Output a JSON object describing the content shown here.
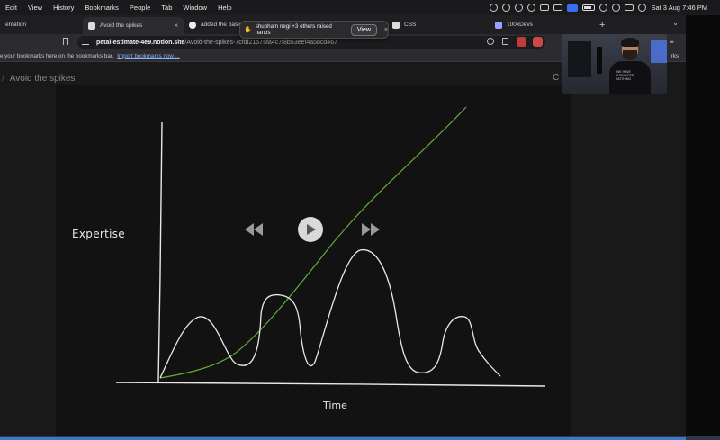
{
  "menubar": {
    "items": [
      "Edit",
      "View",
      "History",
      "Bookmarks",
      "People",
      "Tab",
      "Window",
      "Help"
    ],
    "datetime": "Sat 3 Aug  7:46 PM"
  },
  "tabs": [
    {
      "label": "entation",
      "icon": "doc-icon",
      "active": false
    },
    {
      "label": "Avoid the spikes",
      "icon": "notion-icon",
      "active": true
    },
    {
      "label": "added the basic",
      "icon": "github-icon",
      "active": false
    },
    {
      "label": "CSS",
      "icon": "notion-icon",
      "active": false
    },
    {
      "label": "100xDevs",
      "icon": "doc-icon",
      "active": false
    }
  ],
  "toast": {
    "message": "shubham negi +3 others raised hands",
    "view_label": "View",
    "close_label": "×"
  },
  "address": {
    "domain": "petal-estimate-4e9.notion.site",
    "path": "/Avoid-the-spikes-7cfdf21575fa4c7f8b53eef4a5bcd467"
  },
  "bookmarks": {
    "text": "e your bookmarks here on the bookmarks bar.",
    "link": "Import bookmarks now ...",
    "right": "rks"
  },
  "page": {
    "breadcrumb": "Avoid the spikes",
    "right_letter": "C"
  },
  "chart_labels": {
    "y": "Expertise",
    "x": "Time"
  },
  "webcam": {
    "shirt_text": "WE HAVE STRANGER NOTHING"
  },
  "colors": {
    "green_curve": "#5fae3a",
    "white_curve": "#e8e8e8",
    "canvas_bg": "#121212"
  }
}
